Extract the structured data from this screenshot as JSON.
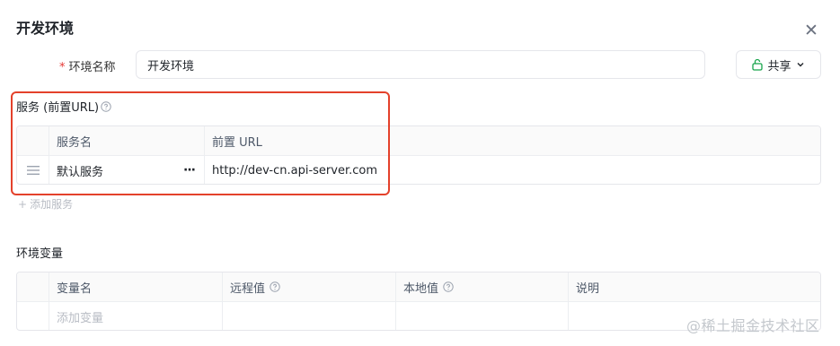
{
  "dialog": {
    "title": "开发环境",
    "close_icon": "close-icon"
  },
  "env_name": {
    "required_mark": "*",
    "label": "环境名称",
    "value": "开发环境"
  },
  "share": {
    "label": "共享",
    "icon": "lock-open-icon"
  },
  "services": {
    "section_label": "服务 (前置URL)",
    "columns": [
      "服务名",
      "前置 URL"
    ],
    "rows": [
      {
        "name": "默认服务",
        "more": "···",
        "url": "http://dev-cn.api-server.com"
      }
    ],
    "add_label": "添加服务",
    "highlight_color": "#e4412b"
  },
  "variables": {
    "section_label": "环境变量",
    "columns": [
      "变量名",
      "远程值",
      "本地值",
      "说明"
    ],
    "add_placeholder": "添加变量"
  },
  "watermark": "@稀土掘金技术社区"
}
